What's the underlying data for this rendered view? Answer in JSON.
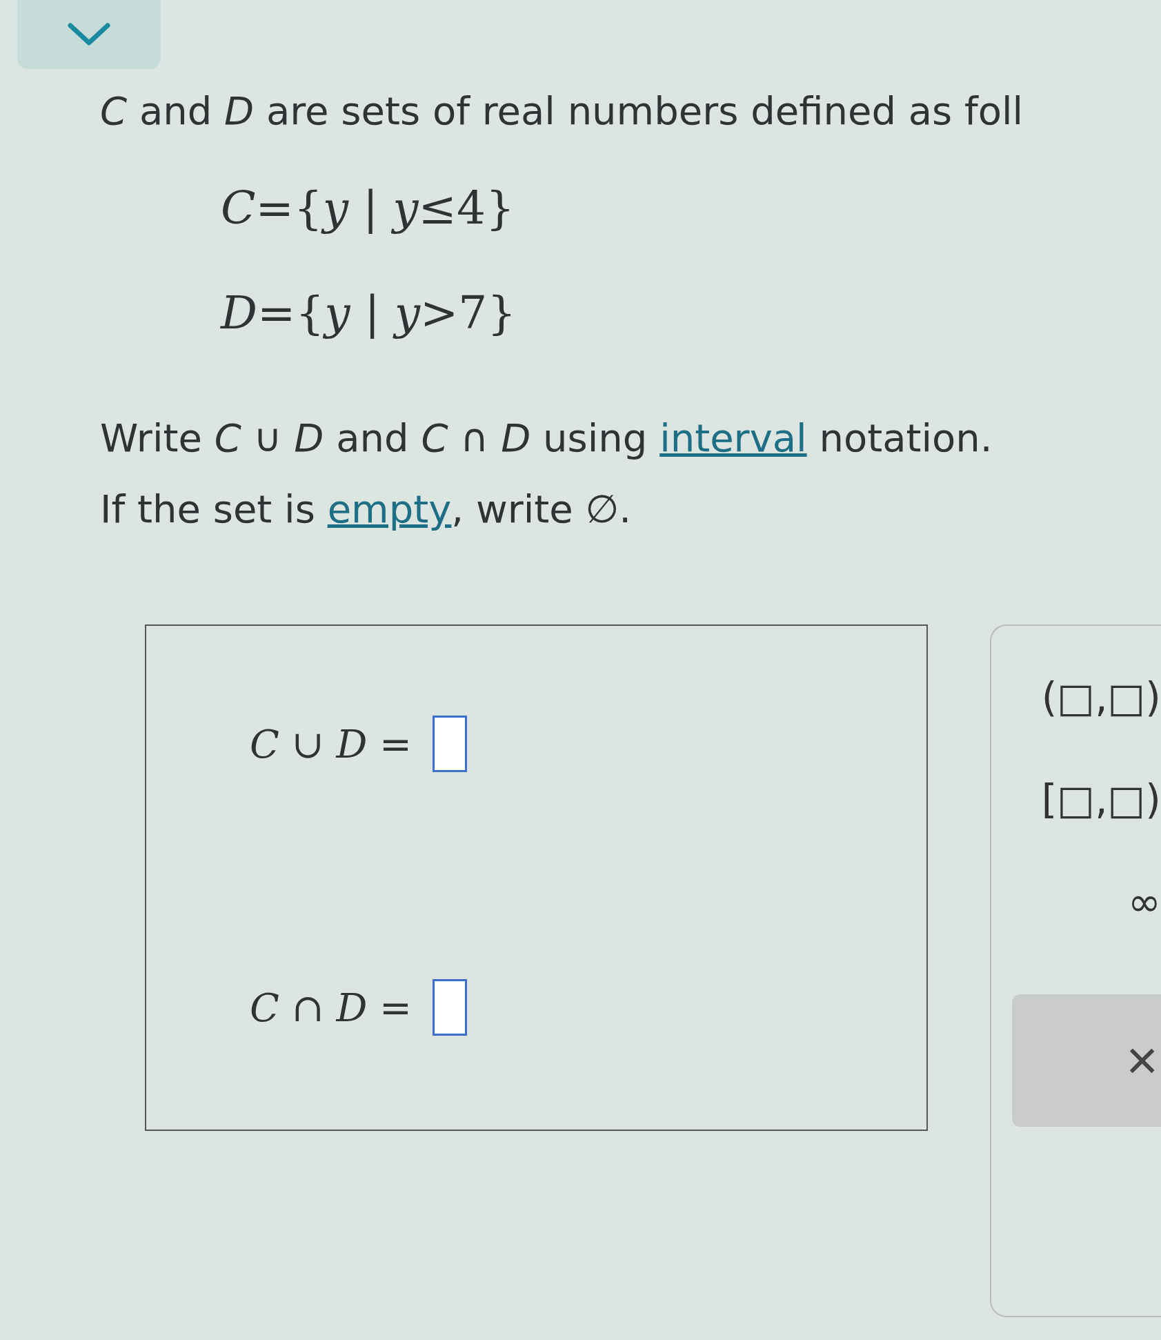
{
  "intro": "*C* and *D* are sets of real numbers defined as foll",
  "definitions": [
    "*C*={*y* | *y*≤4}",
    "*D*={*y* | *y*>7}"
  ],
  "instructions": [
    {
      "before": "Write *C* ∪ *D* and *C* ∩ *D* using ",
      "link": "interval",
      "after": " notation."
    },
    {
      "before": "If the set is ",
      "link": "empty",
      "after": ", write ∅."
    }
  ],
  "answers": [
    {
      "label": "*C* ∪ *D* ="
    },
    {
      "label": "*C* ∩ *D* ="
    }
  ],
  "palette": [
    "(□,□)",
    "[□,□)",
    "∞"
  ],
  "clear_button": "×"
}
